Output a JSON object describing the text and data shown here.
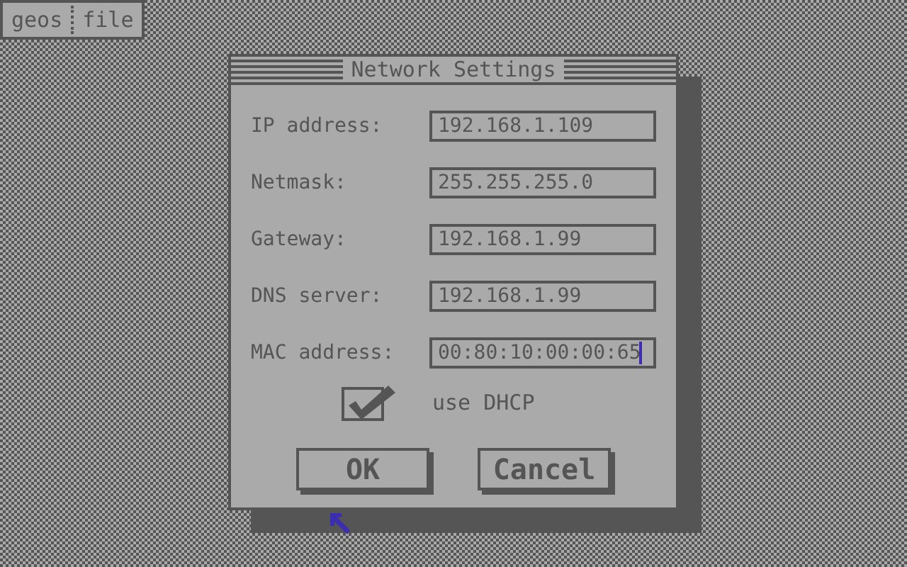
{
  "menu_bar": {
    "items": [
      "geos",
      "file"
    ]
  },
  "dialog": {
    "title": "Network Settings",
    "fields": [
      {
        "label": "IP address:",
        "value": "192.168.1.109",
        "focused": false
      },
      {
        "label": "Netmask:",
        "value": "255.255.255.0",
        "focused": false
      },
      {
        "label": "Gateway:",
        "value": "192.168.1.99",
        "focused": false
      },
      {
        "label": "DNS server:",
        "value": "192.168.1.99",
        "focused": false
      },
      {
        "label": "MAC address:",
        "value": "00:80:10:00:00:65",
        "focused": true
      }
    ],
    "checkbox": {
      "label": "use DHCP",
      "checked": true
    },
    "buttons": [
      "OK",
      "Cancel"
    ]
  }
}
